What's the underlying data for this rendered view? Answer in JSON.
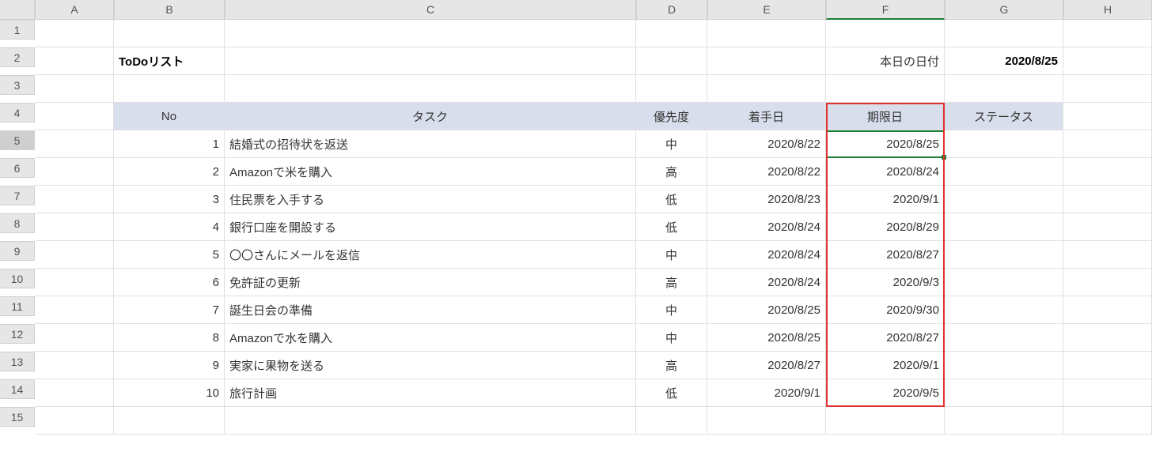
{
  "columns": [
    "A",
    "B",
    "C",
    "D",
    "E",
    "F",
    "G",
    "H"
  ],
  "row_numbers": [
    1,
    2,
    3,
    4,
    5,
    6,
    7,
    8,
    9,
    10,
    11,
    12,
    13,
    14,
    15
  ],
  "title": "ToDoリスト",
  "today_label": "本日の日付",
  "today_value": "2020/8/25",
  "headers": {
    "no": "No",
    "task": "タスク",
    "priority": "優先度",
    "start": "着手日",
    "deadline": "期限日",
    "status": "ステータス"
  },
  "rows": [
    {
      "no": "1",
      "task": "結婚式の招待状を返送",
      "priority": "中",
      "start": "2020/8/22",
      "deadline": "2020/8/25",
      "status": ""
    },
    {
      "no": "2",
      "task": "Amazonで米を購入",
      "priority": "高",
      "start": "2020/8/22",
      "deadline": "2020/8/24",
      "status": ""
    },
    {
      "no": "3",
      "task": "住民票を入手する",
      "priority": "低",
      "start": "2020/8/23",
      "deadline": "2020/9/1",
      "status": ""
    },
    {
      "no": "4",
      "task": "銀行口座を開設する",
      "priority": "低",
      "start": "2020/8/24",
      "deadline": "2020/8/29",
      "status": ""
    },
    {
      "no": "5",
      "task": "〇〇さんにメールを返信",
      "priority": "中",
      "start": "2020/8/24",
      "deadline": "2020/8/27",
      "status": ""
    },
    {
      "no": "6",
      "task": "免許証の更新",
      "priority": "高",
      "start": "2020/8/24",
      "deadline": "2020/9/3",
      "status": ""
    },
    {
      "no": "7",
      "task": "誕生日会の準備",
      "priority": "中",
      "start": "2020/8/25",
      "deadline": "2020/9/30",
      "status": ""
    },
    {
      "no": "8",
      "task": "Amazonで水を購入",
      "priority": "中",
      "start": "2020/8/25",
      "deadline": "2020/8/27",
      "status": ""
    },
    {
      "no": "9",
      "task": "実家に果物を送る",
      "priority": "高",
      "start": "2020/8/27",
      "deadline": "2020/9/1",
      "status": ""
    },
    {
      "no": "10",
      "task": "旅行計画",
      "priority": "低",
      "start": "2020/9/1",
      "deadline": "2020/9/5",
      "status": ""
    }
  ],
  "selected_cell": "F5",
  "highlight_column": "F",
  "highlight_rows": "4-14"
}
